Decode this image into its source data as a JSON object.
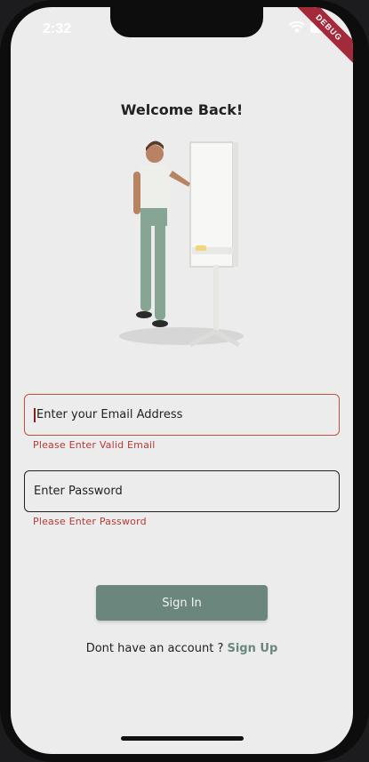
{
  "status_bar": {
    "time": "2:32"
  },
  "debug_banner": "DEBUG",
  "login": {
    "title": "Welcome Back!",
    "email": {
      "placeholder": "Enter your Email Address",
      "error": "Please Enter Valid Email"
    },
    "password": {
      "placeholder": "Enter Password",
      "error": "Please Enter Password"
    },
    "sign_in_label": "Sign In",
    "signup_prompt": "Dont have an account ?",
    "signup_link": "Sign Up"
  },
  "colors": {
    "background": "#ececec",
    "accent": "#6b877d",
    "error": "#b23b3b",
    "email_border": "#c0513f"
  }
}
